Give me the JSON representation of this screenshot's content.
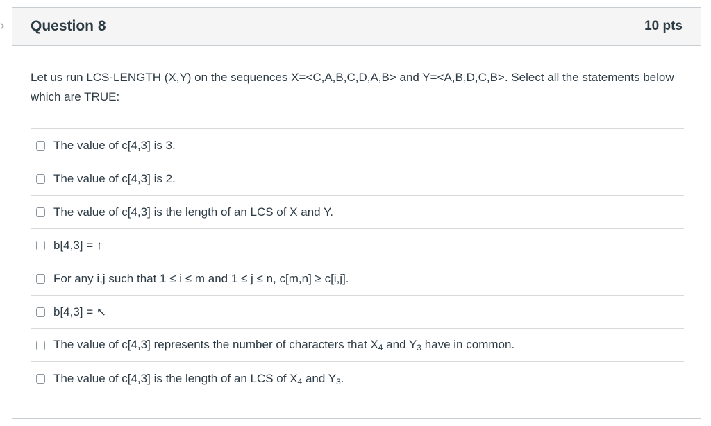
{
  "question": {
    "title": "Question 8",
    "points": "10 pts",
    "prompt": "Let us run LCS-LENGTH (X,Y) on the sequences X=<C,A,B,C,D,A,B> and Y=<A,B,D,C,B>. Select all the statements below which are TRUE:"
  },
  "answers": [
    {
      "parts": [
        "The value of c[4,3] is 3."
      ]
    },
    {
      "parts": [
        "The value of c[4,3] is 2."
      ]
    },
    {
      "parts": [
        "The value of c[4,3] is the length of an LCS of X and Y."
      ]
    },
    {
      "parts": [
        "b[4,3] = ",
        "↑"
      ]
    },
    {
      "parts": [
        "For any i,j such that 1 ≤ i ≤ m and 1 ≤ j ≤ n, c[m,n] ≥ c[i,j]."
      ]
    },
    {
      "parts": [
        "b[4,3] = ",
        "↖"
      ]
    },
    {
      "parts": [
        "The value of c[4,3] represents the number of characters that X",
        "4",
        " and Y",
        "3",
        " have in common."
      ]
    },
    {
      "parts": [
        "The value of c[4,3] is the length of an LCS of X",
        "4",
        " and Y",
        "3",
        "."
      ]
    }
  ]
}
